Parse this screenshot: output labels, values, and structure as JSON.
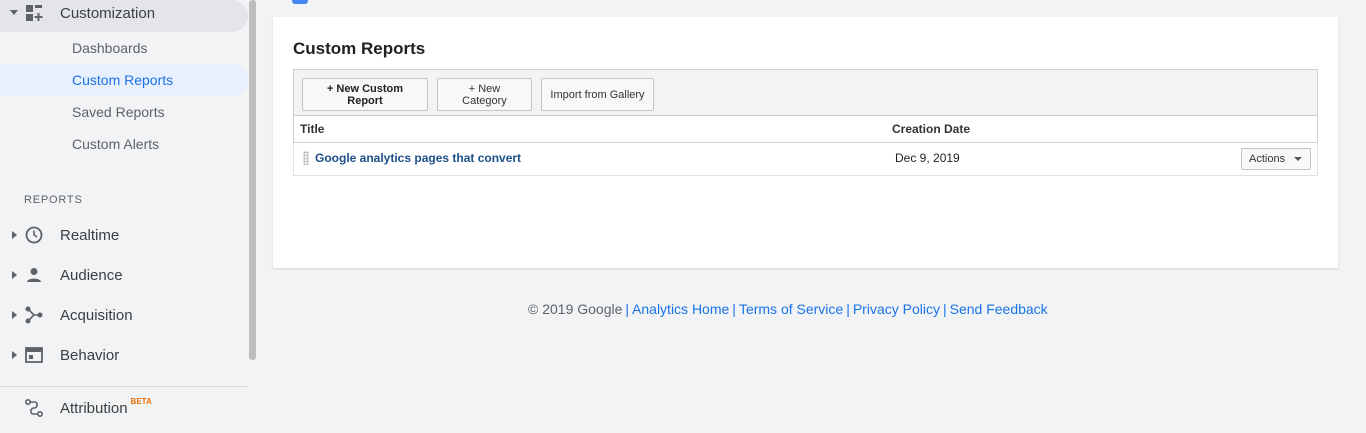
{
  "sidebar": {
    "parent_label": "Customization",
    "sub_items": [
      {
        "label": "Dashboards",
        "active": false
      },
      {
        "label": "Custom Reports",
        "active": true
      },
      {
        "label": "Saved Reports",
        "active": false
      },
      {
        "label": "Custom Alerts",
        "active": false
      }
    ],
    "section_heading": "REPORTS",
    "reports": [
      {
        "label": "Realtime",
        "icon": "clock-icon"
      },
      {
        "label": "Audience",
        "icon": "person-icon"
      },
      {
        "label": "Acquisition",
        "icon": "acquisition-icon"
      },
      {
        "label": "Behavior",
        "icon": "behavior-icon"
      }
    ],
    "attribution": {
      "label": "Attribution",
      "badge": "BETA"
    }
  },
  "main": {
    "title": "Custom Reports",
    "toolbar": {
      "new_report": "+ New Custom Report",
      "new_category": "+ New Category",
      "import_gallery": "Import from Gallery"
    },
    "table": {
      "columns": [
        "Title",
        "Creation Date"
      ],
      "rows": [
        {
          "title": "Google analytics pages that convert",
          "date": "Dec 9, 2019",
          "action": "Actions"
        }
      ]
    }
  },
  "footer": {
    "copyright": "© 2019 Google",
    "links": [
      "Analytics Home",
      "Terms of Service",
      "Privacy Policy",
      "Send Feedback"
    ]
  },
  "colors": {
    "accent": "#1a73e8",
    "active_bg": "#e8f0fe",
    "link": "#1c4f8a",
    "beta": "#e8710a"
  }
}
